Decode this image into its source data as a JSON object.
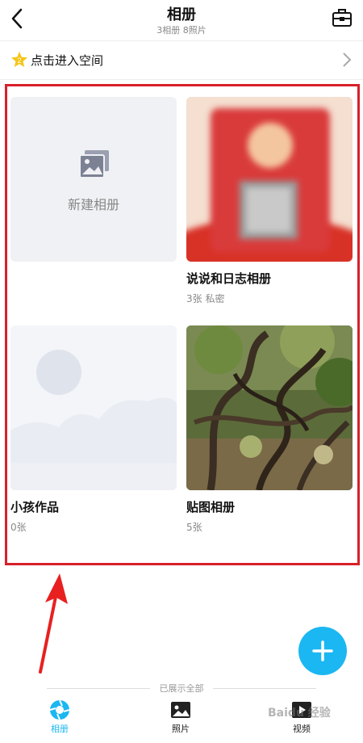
{
  "header": {
    "title": "相册",
    "subtitle": "3相册  8照片"
  },
  "space": {
    "label": "点击进入空间"
  },
  "albums": [
    {
      "name": "",
      "meta": "",
      "new_label": "新建相册"
    },
    {
      "name": "说说和日志相册",
      "meta": "3张  私密"
    },
    {
      "name": "小孩作品",
      "meta": "0张"
    },
    {
      "name": "贴图相册",
      "meta": "5张"
    }
  ],
  "footer": {
    "shown_all": "已展示全部"
  },
  "tabs": [
    {
      "label": "相册"
    },
    {
      "label": "照片"
    },
    {
      "label": "视频"
    }
  ],
  "colors": {
    "accent": "#1bb7f2",
    "highlight": "#d8202a"
  },
  "watermark": "Baidu 经验"
}
